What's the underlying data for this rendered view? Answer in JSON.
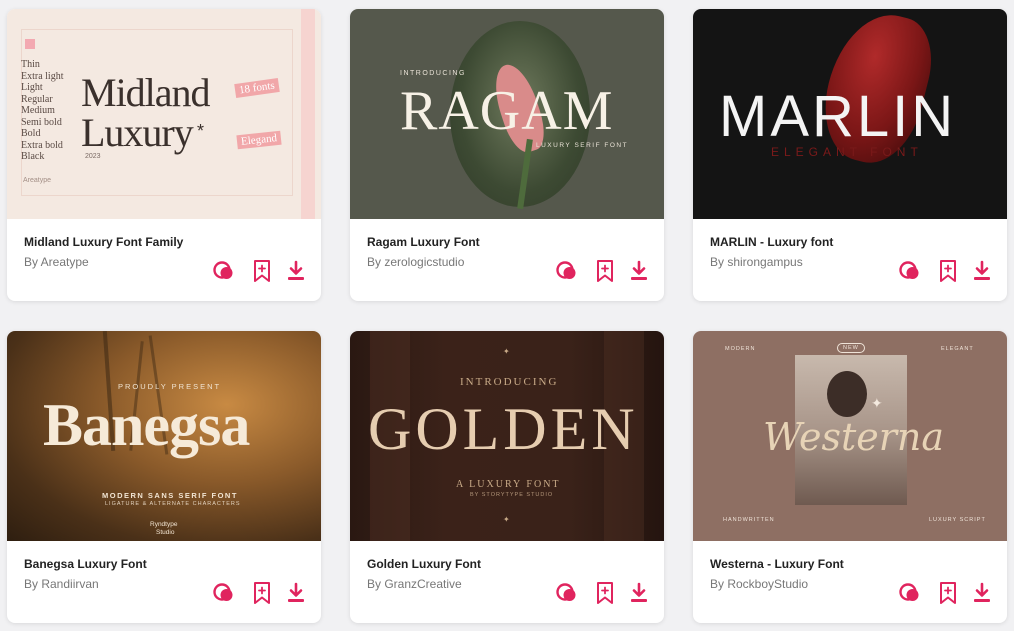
{
  "colors": {
    "accent": "#e0245e",
    "background": "#f1f1f3"
  },
  "icons": {
    "lookup": "font-match-icon",
    "save": "bookmark-plus-icon",
    "download": "download-icon"
  },
  "cards": [
    {
      "title": "Midland Luxury Font Family",
      "author": "By Areatype",
      "preview": {
        "headline1": "Midland",
        "headline2": "Luxury",
        "asterisk": "*",
        "year": "2023",
        "weights": [
          "Thin",
          "Extra light",
          "Light",
          "Regular",
          "Medium",
          "Semi bold",
          "Bold",
          "Extra bold",
          "Black"
        ],
        "badge1": "18 fonts",
        "badge2": "Elegand",
        "brand": "Areatype"
      }
    },
    {
      "title": "Ragam Luxury Font",
      "author": "By zerologicstudio",
      "preview": {
        "kicker": "INTRODUCING",
        "headline": "RAGAM",
        "sub": "LUXURY SERIF FONT"
      }
    },
    {
      "title": "MARLIN - Luxury font",
      "author": "By shirongampus",
      "preview": {
        "headline": "MARLIN",
        "sub": "ELEGANT FONT"
      }
    },
    {
      "title": "Banegsa Luxury Font",
      "author": "By Randiirvan",
      "preview": {
        "kicker": "PROUDLY PRESENT",
        "headline": "Banegsa",
        "sub": "MODERN SANS SERIF FONT",
        "sub2": "LIGATURE & ALTERNATE CHARACTERS",
        "brand1": "Ryndtype",
        "brand2": "Studio"
      }
    },
    {
      "title": "Golden Luxury Font",
      "author": "By GranzCreative",
      "preview": {
        "kicker": "INTRODUCING",
        "headline": "GOLDEN",
        "sub": "A LUXURY FONT",
        "sub2": "BY STORYTYPE STUDIO"
      }
    },
    {
      "title": "Westerna - Luxury Font",
      "author": "By RockboyStudio",
      "preview": {
        "headline": "Westerna",
        "tl": "MODERN",
        "tc": "NEW",
        "tr": "ELEGANT",
        "bl": "HANDWRITTEN",
        "br": "LUXURY SCRIPT"
      }
    }
  ]
}
